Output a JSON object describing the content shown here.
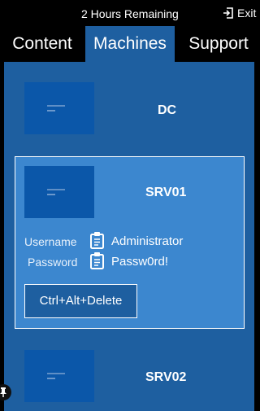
{
  "header": {
    "time_remaining": "2 Hours Remaining",
    "exit_label": "Exit"
  },
  "tabs": [
    {
      "label": "Content",
      "active": false
    },
    {
      "label": "Machines",
      "active": true
    },
    {
      "label": "Support",
      "active": false
    }
  ],
  "machines": [
    {
      "name": "DC",
      "selected": false
    },
    {
      "name": "SRV01",
      "selected": true,
      "username_label": "Username",
      "username": "Administrator",
      "password_label": "Password",
      "password": "Passw0rd!",
      "cad_label": "Ctrl+Alt+Delete"
    },
    {
      "name": "SRV02",
      "selected": false
    }
  ],
  "colors": {
    "accent": "#1e5fa0",
    "selected_card": "#3c87cf",
    "thumbnail": "#0b57a9",
    "background": "#000000"
  },
  "icons": {
    "exit": "exit-door-icon",
    "copy": "clipboard-icon",
    "side_handle": "pin-icon"
  }
}
